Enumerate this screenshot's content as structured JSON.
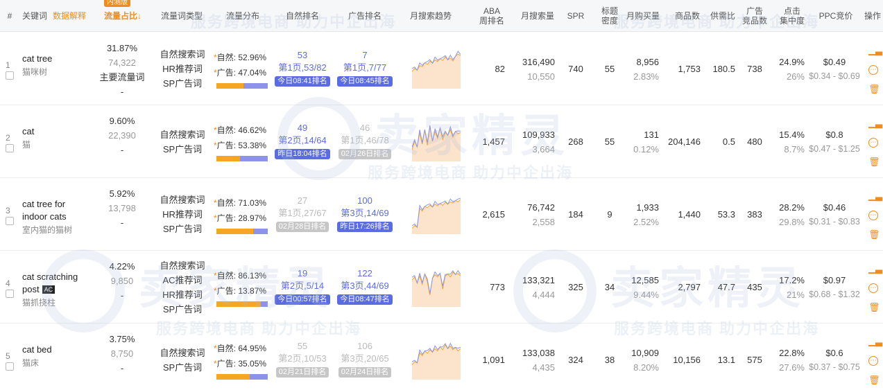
{
  "watermark": {
    "line": "服务跨境电商 助力中企出海",
    "logo": "卖家精灵"
  },
  "header": {
    "index": "#",
    "keyword": "关键词",
    "data_help": "数据解释",
    "new_badge": "内测版",
    "traffic_share": "流量占比↓",
    "kw_type": "流量词类型",
    "traffic_dist": "流量分布",
    "organic_rank": "自然排名",
    "ad_rank": "广告排名",
    "trend": "月搜索趋势",
    "aba_1": "ABA",
    "aba_2": "周排名",
    "monthly_search": "月搜索量",
    "spr": "SPR",
    "title_1": "标题",
    "title_2": "密度",
    "monthly_buy": "月购买量",
    "products": "商品数",
    "supply": "供需比",
    "ad_1": "广告",
    "ad_2": "竞品数",
    "click_1": "点击",
    "click_2": "集中度",
    "ppc": "PPC竞价",
    "ops": "操作"
  },
  "rows": [
    {
      "idx": "1",
      "kw": "cat tree",
      "ac": "",
      "kw_cn": "猫咪树",
      "share": "31.87%",
      "traffic": "74,322",
      "main": "主要流量词",
      "dash": "-",
      "types": [
        "自然搜索词",
        "HR推荐词",
        "SP广告词"
      ],
      "org_label": "自然:",
      "org_pct": "52.96%",
      "ad_label": "广告:",
      "ad_pct": "47.04%",
      "org_frac": 0.5296,
      "r_org": {
        "n": "53",
        "p": "第1页,53/82",
        "t": "今日08:41排名",
        "active": true
      },
      "r_ad": {
        "n": "7",
        "p": "第1页,7/77",
        "t": "今日08:45排名",
        "active": true
      },
      "aba": "82",
      "ms": "316,490",
      "ms2": "10,550",
      "spr": "740",
      "td": "55",
      "buy": "8,956",
      "buy_pct": "2.83%",
      "products": "1,753",
      "supply": "180.5",
      "adc": "738",
      "click": "24.9%",
      "click2": "26%",
      "ppc": "$0.49",
      "ppc_range": "$0.34 - $0.69",
      "trend": [
        30,
        35,
        32,
        40,
        38,
        45,
        42,
        48,
        44,
        50,
        47,
        52,
        49,
        55,
        50,
        53,
        48,
        56,
        60,
        57
      ]
    },
    {
      "idx": "2",
      "kw": "cat",
      "ac": "",
      "kw_cn": "猫",
      "share": "9.60%",
      "traffic": "22,390",
      "main": "",
      "dash": "-",
      "types": [
        "自然搜索词",
        "SP广告词"
      ],
      "org_label": "自然:",
      "org_pct": "46.62%",
      "ad_label": "广告:",
      "ad_pct": "53.38%",
      "org_frac": 0.4662,
      "r_org": {
        "n": "49",
        "p": "第2页,14/64",
        "t": "昨日18:04排名",
        "active": true
      },
      "r_ad": {
        "n": "46",
        "p": "第1页,46/78",
        "t": "02月26日排名",
        "active": false
      },
      "aba": "1,457",
      "ms": "109,933",
      "ms2": "3,664",
      "spr": "268",
      "td": "55",
      "buy": "131",
      "buy_pct": "0.12%",
      "products": "204,146",
      "supply": "0.5",
      "adc": "480",
      "click": "15.4%",
      "click2": "8.7%",
      "ppc": "$0.8",
      "ppc_range": "$0.47 - $1.25",
      "trend": [
        20,
        35,
        25,
        50,
        30,
        55,
        28,
        60,
        35,
        52,
        40,
        58,
        38,
        50,
        45,
        55,
        42,
        52,
        48,
        50
      ]
    },
    {
      "idx": "3",
      "kw": "cat tree for indoor cats",
      "ac": "",
      "kw_cn": "室内猫的猫树",
      "share": "5.92%",
      "traffic": "13,798",
      "main": "",
      "dash": "-",
      "types": [
        "自然搜索词",
        "HR推荐词",
        "SP广告词"
      ],
      "org_label": "自然:",
      "org_pct": "71.03%",
      "ad_label": "广告:",
      "ad_pct": "28.97%",
      "org_frac": 0.7103,
      "r_org": {
        "n": "27",
        "p": "第1页,27/67",
        "t": "02月28日排名",
        "active": false
      },
      "r_ad": {
        "n": "100",
        "p": "第3页,14/69",
        "t": "昨日17:26排名",
        "active": true
      },
      "aba": "2,615",
      "ms": "76,742",
      "ms2": "2,558",
      "spr": "184",
      "td": "9",
      "buy": "1,933",
      "buy_pct": "2.52%",
      "products": "1,440",
      "supply": "53.3",
      "adc": "383",
      "click": "28.2%",
      "click2": "29.8%",
      "ppc": "$0.46",
      "ppc_range": "$0.31 - $0.83",
      "trend": [
        10,
        15,
        12,
        45,
        40,
        48,
        46,
        50,
        47,
        52,
        49,
        53,
        50,
        55,
        52,
        56,
        54,
        58,
        56,
        60
      ]
    },
    {
      "idx": "4",
      "kw": "cat scratching post",
      "ac": "AC",
      "kw_cn": "猫抓挠柱",
      "share": "4.22%",
      "traffic": "9,850",
      "main": "",
      "dash": "-",
      "types": [
        "自然搜索词",
        "AC推荐词",
        "HR推荐词",
        "SP广告词"
      ],
      "org_label": "自然:",
      "org_pct": "86.13%",
      "ad_label": "广告:",
      "ad_pct": "13.87%",
      "org_frac": 0.8613,
      "r_org": {
        "n": "19",
        "p": "第2页,5/14",
        "t": "今日00:57排名",
        "active": true
      },
      "r_ad": {
        "n": "122",
        "p": "第3页,44/69",
        "t": "今日08:47排名",
        "active": true
      },
      "aba": "773",
      "ms": "133,321",
      "ms2": "4,444",
      "spr": "325",
      "td": "34",
      "buy": "12,585",
      "buy_pct": "9.44%",
      "products": "2,797",
      "supply": "47.7",
      "adc": "435",
      "click": "17.2%",
      "click2": "21%",
      "ppc": "$0.97",
      "ppc_range": "$0.68 - $1.32",
      "trend": [
        45,
        50,
        40,
        52,
        38,
        55,
        42,
        20,
        48,
        54,
        50,
        56,
        30,
        52,
        55,
        50,
        58,
        54,
        56,
        52
      ]
    },
    {
      "idx": "5",
      "kw": "cat bed",
      "ac": "",
      "kw_cn": "猫床",
      "share": "3.75%",
      "traffic": "8,750",
      "main": "",
      "dash": "-",
      "types": [
        "自然搜索词",
        "SP广告词"
      ],
      "org_label": "自然:",
      "org_pct": "64.95%",
      "ad_label": "广告:",
      "ad_pct": "35.05%",
      "org_frac": 0.6495,
      "r_org": {
        "n": "55",
        "p": "第2页,10/53",
        "t": "02月21日排名",
        "active": false
      },
      "r_ad": {
        "n": "106",
        "p": "第3页,20/65",
        "t": "02月24日排名",
        "active": false
      },
      "aba": "1,091",
      "ms": "133,038",
      "ms2": "4,435",
      "spr": "324",
      "td": "38",
      "buy": "10,909",
      "buy_pct": "8.20%",
      "products": "10,156",
      "supply": "13.1",
      "adc": "575",
      "click": "22.8%",
      "click2": "27.6%",
      "ppc": "$0.6",
      "ppc_range": "$0.37 - $0.75",
      "trend": [
        25,
        30,
        28,
        45,
        40,
        48,
        44,
        50,
        46,
        52,
        48,
        55,
        50,
        58,
        52,
        56,
        50,
        54,
        48,
        52
      ]
    }
  ],
  "colors": {
    "accent": "#f08c1e",
    "rank_blue": "#5b6ce0",
    "trend_fill": "#fce3cc",
    "trend_line_org": "#f5a623",
    "trend_line_blue": "#8c93e8"
  }
}
